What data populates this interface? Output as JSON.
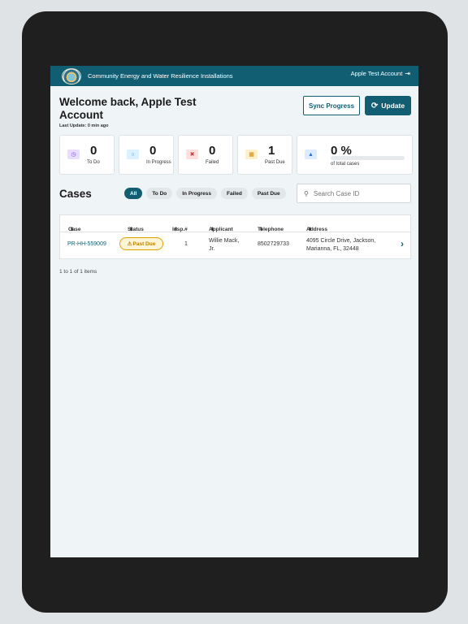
{
  "header_bar": {
    "title": "Community Energy and Water Resilience Installations",
    "account": "Apple Test Account"
  },
  "welcome": {
    "greeting": "Welcome back, Apple Test Account",
    "last_update": "Last Update:  0 min ago"
  },
  "actions": {
    "sync": "Sync Progress",
    "update": "Update"
  },
  "stats": [
    {
      "value": "0",
      "label": "To Do",
      "color": "#e8dcff",
      "icon": "clock-icon"
    },
    {
      "value": "0",
      "label": "In Progress",
      "color": "#dcf1ff",
      "icon": "refresh-icon"
    },
    {
      "value": "0",
      "label": "Failed",
      "color": "#ffdede",
      "icon": "x-icon"
    },
    {
      "value": "1",
      "label": "Past Due",
      "color": "#fff0cc",
      "icon": "calendar-icon"
    }
  ],
  "progress": {
    "value": "0 %",
    "label": "of total cases",
    "fraction": 0,
    "icon": "chart-icon"
  },
  "cases": {
    "title": "Cases",
    "filters": [
      "All",
      "To Do",
      "In Progress",
      "Failed",
      "Past Due"
    ],
    "search_placeholder": "Search Case ID"
  },
  "table": {
    "headers": [
      "Case",
      "Status",
      "Insp.#",
      "Applicant",
      "Telephone",
      "Address"
    ],
    "rows": [
      {
        "case": "PR-HH-559009",
        "status": "Past Due",
        "insp": "1",
        "applicant_line1": "Willie Mack,",
        "applicant_line2": "Jr.",
        "telephone": "8502729733",
        "address_line1": "4095 Circle Drive, Jackson,",
        "address_line2": "Marianna, FL, 32448"
      }
    ]
  },
  "pager": "1 to 1 of 1 items",
  "colors": {
    "brand": "#115e73",
    "warning": "#e0a100"
  }
}
